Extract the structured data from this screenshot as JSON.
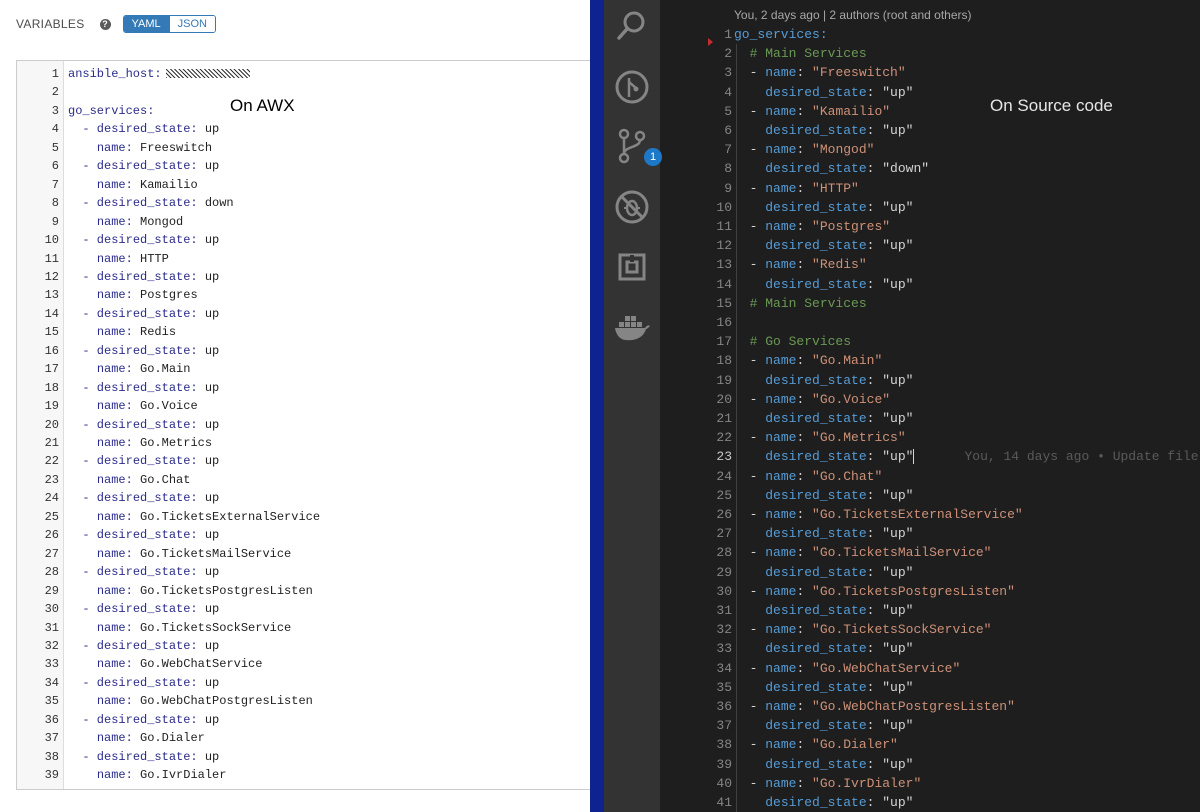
{
  "awx": {
    "variables_label": "VARIABLES",
    "help_icon": "?",
    "toggle": {
      "yaml": "YAML",
      "json": "JSON",
      "active": "YAML"
    },
    "caption": "On AWX",
    "lines": [
      {
        "n": "1",
        "key": "ansible_host:",
        "val": "",
        "indent": 0,
        "redacted": true
      },
      {
        "n": "2",
        "key": "",
        "val": "",
        "indent": 0
      },
      {
        "n": "3",
        "key": "go_services:",
        "val": "",
        "indent": 0
      },
      {
        "n": "4",
        "key": "- desired_state:",
        "val": " up",
        "indent": 2
      },
      {
        "n": "5",
        "key": "name:",
        "val": " Freeswitch",
        "indent": 4
      },
      {
        "n": "6",
        "key": "- desired_state:",
        "val": " up",
        "indent": 2
      },
      {
        "n": "7",
        "key": "name:",
        "val": " Kamailio",
        "indent": 4
      },
      {
        "n": "8",
        "key": "- desired_state:",
        "val": " down",
        "indent": 2
      },
      {
        "n": "9",
        "key": "name:",
        "val": " Mongod",
        "indent": 4
      },
      {
        "n": "10",
        "key": "- desired_state:",
        "val": " up",
        "indent": 2
      },
      {
        "n": "11",
        "key": "name:",
        "val": " HTTP",
        "indent": 4
      },
      {
        "n": "12",
        "key": "- desired_state:",
        "val": " up",
        "indent": 2
      },
      {
        "n": "13",
        "key": "name:",
        "val": " Postgres",
        "indent": 4
      },
      {
        "n": "14",
        "key": "- desired_state:",
        "val": " up",
        "indent": 2
      },
      {
        "n": "15",
        "key": "name:",
        "val": " Redis",
        "indent": 4
      },
      {
        "n": "16",
        "key": "- desired_state:",
        "val": " up",
        "indent": 2
      },
      {
        "n": "17",
        "key": "name:",
        "val": " Go.Main",
        "indent": 4
      },
      {
        "n": "18",
        "key": "- desired_state:",
        "val": " up",
        "indent": 2
      },
      {
        "n": "19",
        "key": "name:",
        "val": " Go.Voice",
        "indent": 4
      },
      {
        "n": "20",
        "key": "- desired_state:",
        "val": " up",
        "indent": 2
      },
      {
        "n": "21",
        "key": "name:",
        "val": " Go.Metrics",
        "indent": 4
      },
      {
        "n": "22",
        "key": "- desired_state:",
        "val": " up",
        "indent": 2
      },
      {
        "n": "23",
        "key": "name:",
        "val": " Go.Chat",
        "indent": 4
      },
      {
        "n": "24",
        "key": "- desired_state:",
        "val": " up",
        "indent": 2
      },
      {
        "n": "25",
        "key": "name:",
        "val": " Go.TicketsExternalService",
        "indent": 4
      },
      {
        "n": "26",
        "key": "- desired_state:",
        "val": " up",
        "indent": 2
      },
      {
        "n": "27",
        "key": "name:",
        "val": " Go.TicketsMailService",
        "indent": 4
      },
      {
        "n": "28",
        "key": "- desired_state:",
        "val": " up",
        "indent": 2
      },
      {
        "n": "29",
        "key": "name:",
        "val": " Go.TicketsPostgresListen",
        "indent": 4
      },
      {
        "n": "30",
        "key": "- desired_state:",
        "val": " up",
        "indent": 2
      },
      {
        "n": "31",
        "key": "name:",
        "val": " Go.TicketsSockService",
        "indent": 4
      },
      {
        "n": "32",
        "key": "- desired_state:",
        "val": " up",
        "indent": 2
      },
      {
        "n": "33",
        "key": "name:",
        "val": " Go.WebChatService",
        "indent": 4
      },
      {
        "n": "34",
        "key": "- desired_state:",
        "val": " up",
        "indent": 2
      },
      {
        "n": "35",
        "key": "name:",
        "val": " Go.WebChatPostgresListen",
        "indent": 4
      },
      {
        "n": "36",
        "key": "- desired_state:",
        "val": " up",
        "indent": 2
      },
      {
        "n": "37",
        "key": "name:",
        "val": " Go.Dialer",
        "indent": 4
      },
      {
        "n": "38",
        "key": "- desired_state:",
        "val": " up",
        "indent": 2
      },
      {
        "n": "39",
        "key": "name:",
        "val": " Go.IvrDialer",
        "indent": 4
      }
    ]
  },
  "vscode": {
    "blame_header": "You, 2 days ago | 2 authors (root and others)",
    "caption": "On Source code",
    "scm_badge": "1",
    "activity_icons": [
      "search-icon",
      "git-history-icon",
      "source-control-icon",
      "debug-icon",
      "extensions-icon",
      "docker-icon"
    ],
    "current_line": "23",
    "inline_blame": "You, 14 days ago • Update file",
    "lines": [
      {
        "n": "1",
        "type": "top",
        "key": "go_services:",
        "val": ""
      },
      {
        "n": "2",
        "type": "comment",
        "text": "# Main Services"
      },
      {
        "n": "3",
        "type": "name",
        "val": "\"Freeswitch\""
      },
      {
        "n": "4",
        "type": "state",
        "val": "\"up\""
      },
      {
        "n": "5",
        "type": "name",
        "val": "\"Kamailio\""
      },
      {
        "n": "6",
        "type": "state",
        "val": "\"up\""
      },
      {
        "n": "7",
        "type": "name",
        "val": "\"Mongod\""
      },
      {
        "n": "8",
        "type": "state",
        "val": "\"down\""
      },
      {
        "n": "9",
        "type": "name",
        "val": "\"HTTP\""
      },
      {
        "n": "10",
        "type": "state",
        "val": "\"up\""
      },
      {
        "n": "11",
        "type": "name",
        "val": "\"Postgres\""
      },
      {
        "n": "12",
        "type": "state",
        "val": "\"up\""
      },
      {
        "n": "13",
        "type": "name",
        "val": "\"Redis\""
      },
      {
        "n": "14",
        "type": "state",
        "val": "\"up\""
      },
      {
        "n": "15",
        "type": "comment",
        "text": "# Main Services"
      },
      {
        "n": "16",
        "type": "blank"
      },
      {
        "n": "17",
        "type": "comment",
        "text": "# Go Services"
      },
      {
        "n": "18",
        "type": "name",
        "val": "\"Go.Main\""
      },
      {
        "n": "19",
        "type": "state",
        "val": "\"up\""
      },
      {
        "n": "20",
        "type": "name",
        "val": "\"Go.Voice\""
      },
      {
        "n": "21",
        "type": "state",
        "val": "\"up\""
      },
      {
        "n": "22",
        "type": "name",
        "val": "\"Go.Metrics\""
      },
      {
        "n": "23",
        "type": "state",
        "val": "\"up\"",
        "current": true
      },
      {
        "n": "24",
        "type": "name",
        "val": "\"Go.Chat\""
      },
      {
        "n": "25",
        "type": "state",
        "val": "\"up\""
      },
      {
        "n": "26",
        "type": "name",
        "val": "\"Go.TicketsExternalService\""
      },
      {
        "n": "27",
        "type": "state",
        "val": "\"up\""
      },
      {
        "n": "28",
        "type": "name",
        "val": "\"Go.TicketsMailService\""
      },
      {
        "n": "29",
        "type": "state",
        "val": "\"up\""
      },
      {
        "n": "30",
        "type": "name",
        "val": "\"Go.TicketsPostgresListen\""
      },
      {
        "n": "31",
        "type": "state",
        "val": "\"up\""
      },
      {
        "n": "32",
        "type": "name",
        "val": "\"Go.TicketsSockService\""
      },
      {
        "n": "33",
        "type": "state",
        "val": "\"up\""
      },
      {
        "n": "34",
        "type": "name",
        "val": "\"Go.WebChatService\""
      },
      {
        "n": "35",
        "type": "state",
        "val": "\"up\""
      },
      {
        "n": "36",
        "type": "name",
        "val": "\"Go.WebChatPostgresListen\""
      },
      {
        "n": "37",
        "type": "state",
        "val": "\"up\""
      },
      {
        "n": "38",
        "type": "name",
        "val": "\"Go.Dialer\""
      },
      {
        "n": "39",
        "type": "state",
        "val": "\"up\""
      },
      {
        "n": "40",
        "type": "name",
        "val": "\"Go.IvrDialer\""
      },
      {
        "n": "41",
        "type": "state",
        "val": "\"up\""
      }
    ]
  }
}
